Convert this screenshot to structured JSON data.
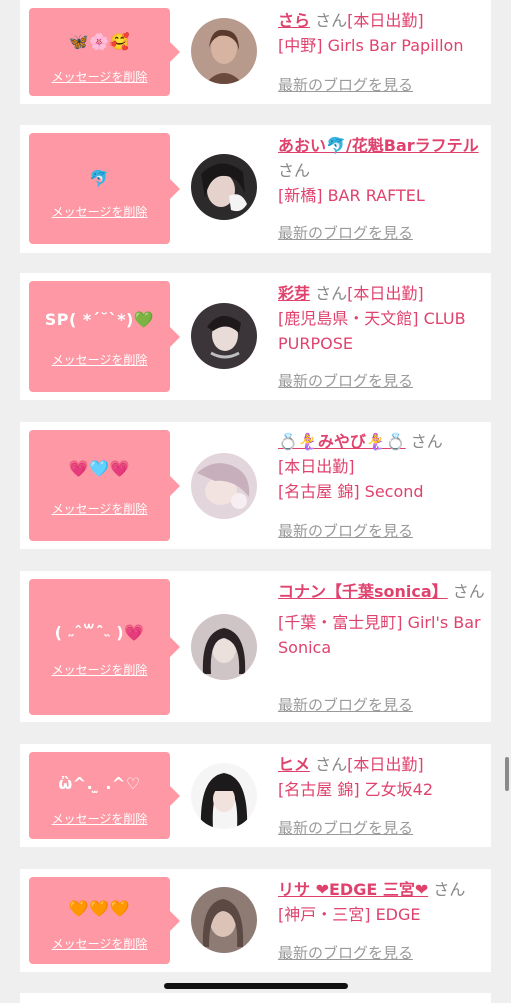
{
  "messages": [
    {
      "stamp": "🦋🌸🥰",
      "delete_label": "メッセージを削除",
      "name": "さら",
      "honorific": "さん",
      "status": "[本日出勤]",
      "shop": "[中野] Girls Bar Papillon",
      "blog_label": "最新のブログを見る",
      "avatar_color": "#8a6a5e"
    },
    {
      "stamp": "🐬",
      "delete_label": "メッセージを削除",
      "name": "あおい🐬/花魁Barラフテル",
      "honorific": "さん",
      "status": "",
      "shop": "[新橋] BAR RAFTEL",
      "blog_label": "最新のブログを見る",
      "avatar_color": "#2d2a2c"
    },
    {
      "stamp": "SP( *´˘`*)💚",
      "delete_label": "メッセージを削除",
      "name": "彩芽",
      "honorific": "さん",
      "status": "[本日出勤]",
      "shop": "[鹿児島県・天文館] CLUB PURPOSE",
      "blog_label": "最新のブログを見る",
      "avatar_color": "#3b3438"
    },
    {
      "stamp": "💗🩵💗",
      "delete_label": "メッセージを削除",
      "name": "💍🧜‍♀️みやび🧜‍♀️💍",
      "honorific": "さん",
      "status": "[本日出勤]",
      "shop": "[名古屋 錦] Second",
      "blog_label": "最新のブログを見る",
      "avatar_color": "#e3d5dc"
    },
    {
      "stamp": "( ˶ˆ꒳ˆ˵ )💗",
      "delete_label": "メッセージを削除",
      "name": "コナン【千葉sonica】",
      "honorific": "さん",
      "status": "",
      "shop": "[千葉・富士見町] Girl's Bar Sonica",
      "blog_label": "最新のブログを見る",
      "avatar_color": "#4d4042"
    },
    {
      "stamp": "ὢ^. ̫ .^♡",
      "delete_label": "メッセージを削除",
      "name": "ヒメ",
      "honorific": "さん",
      "status": "[本日出勤]",
      "shop": "[名古屋 錦] 乙女坂42",
      "blog_label": "最新のブログを見る",
      "avatar_color": "#2a2426"
    },
    {
      "stamp": "🧡🧡🧡",
      "delete_label": "メッセージを削除",
      "name": "リサ ❤EDGE 三宮❤",
      "honorific": "さん",
      "status": "",
      "shop": "[神戸・三宮] EDGE",
      "blog_label": "最新のブログを見る",
      "avatar_color": "#8d7b74"
    }
  ]
}
